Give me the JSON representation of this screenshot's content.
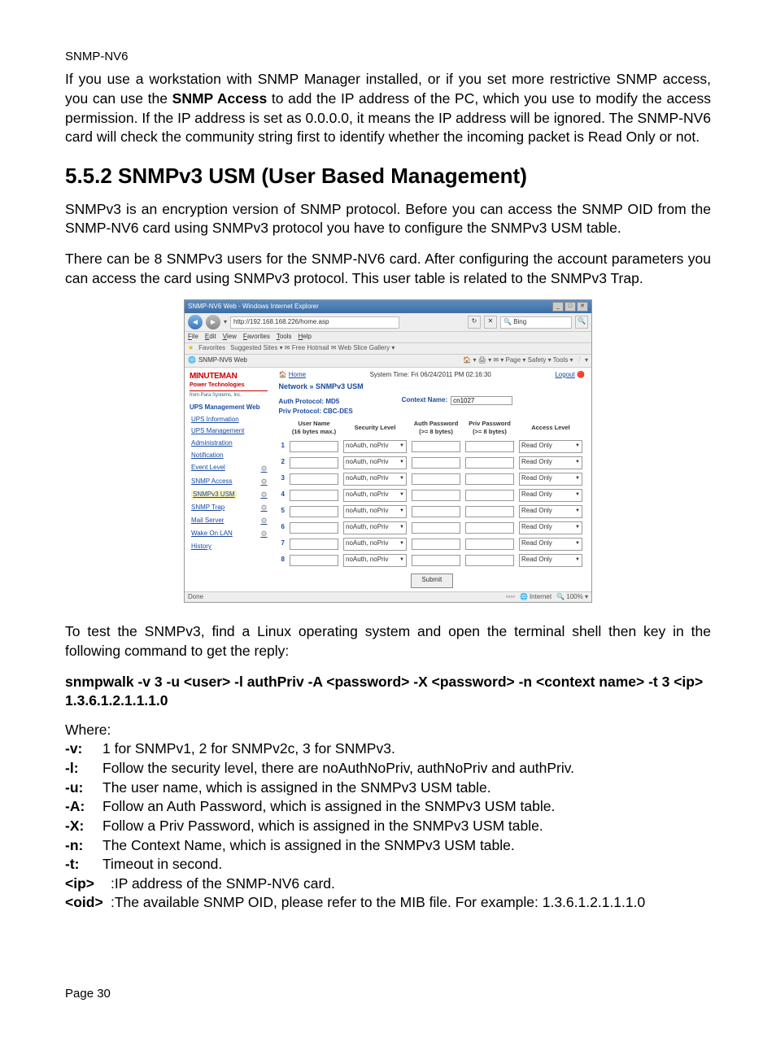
{
  "header": "SNMP-NV6",
  "intro_paragraph": "If you use a workstation with SNMP Manager installed, or if you set more restrictive SNMP access, you can use the SNMP Access to add the IP address of the PC, which you use to modify the access permission. If the IP address is set as 0.0.0.0, it means the IP address will be ignored. The SNMP-NV6 card will check the community string first to identify whether the incoming packet is Read Only or not.",
  "intro_bold": "SNMP Access",
  "section_heading": "5.5.2 SNMPv3 USM (User Based Management)",
  "para1": "SNMPv3 is an encryption version of SNMP protocol. Before you can access the SNMP OID from the SNMP-NV6 card using SNMPv3 protocol you have to configure the SNMPv3 USM table.",
  "para2": "There can be 8 SNMPv3 users for the SNMP-NV6 card. After configuring the account parameters you can access the card using SNMPv3 protocol. This user table is related to the SNMPv3 Trap.",
  "screenshot": {
    "title": "SNMP-NV6 Web - Windows Internet Explorer",
    "url": "http://192.168.168.226/home.asp",
    "search_hint": "Bing",
    "menu": [
      "File",
      "Edit",
      "View",
      "Favorites",
      "Tools",
      "Help"
    ],
    "fav_label": "Favorites",
    "fav_links": "Suggested Sites ▾  ✉ Free Hotmail  ✉ Web Slice Gallery ▾",
    "tab": "SNMP-NV6 Web",
    "toolbar_right": "🏠 ▾  🖨 ▾  ✉ ▾  Page ▾  Safety ▾  Tools ▾  ❔ ▾",
    "logo1": "MINUTEMAN",
    "logo2": "Power Technologies",
    "logo3": "from Para Systems, Inc.",
    "sidebar_section": "UPS Management Web",
    "sidebar_items": [
      "UPS Information",
      "UPS Management",
      "Administration",
      "Notification"
    ],
    "sidebar_sub": [
      {
        "label": "Event Level",
        "gear": true
      },
      {
        "label": "SNMP Access",
        "gear": true
      },
      {
        "label": "SNMPv3 USM",
        "gear": true,
        "selected": true
      },
      {
        "label": "SNMP Trap",
        "gear": true
      },
      {
        "label": "Mail Server",
        "gear": true
      },
      {
        "label": "Wake On LAN",
        "gear": true
      },
      {
        "label": "History",
        "gear": false
      }
    ],
    "home_link": "Home",
    "system_time": "System Time: Fri 06/24/2011 PM 02:16:30",
    "logout": "Logout",
    "breadcrumb": "Network » SNMPv3 USM",
    "auth_proto": "Auth Protocol: MD5",
    "priv_proto": "Priv Protocol: CBC-DES",
    "context_label": "Context Name:",
    "context_value": "cn1027",
    "columns": [
      "",
      "User Name\n(16 bytes max.)",
      "Security Level",
      "Auth Password\n(>= 8 bytes)",
      "Priv Password\n(>= 8 bytes)",
      "Access Level"
    ],
    "rows": [
      1,
      2,
      3,
      4,
      5,
      6,
      7,
      8
    ],
    "security_option": "noAuth, noPriv",
    "access_option": "Read Only",
    "submit": "Submit",
    "status_left": "Done",
    "status_zone": "Internet",
    "status_zoom": "100%"
  },
  "para3": "To test the SNMPv3, find a Linux operating system and open the terminal shell then key in the following command to get the reply:",
  "command": "snmpwalk -v 3 -u <user> -l authPriv -A <password> -X <password> -n <context name> -t 3 <ip> 1.3.6.1.2.1.1.1.0",
  "where_label": "Where:",
  "where": [
    {
      "k": "-v:",
      "v": "1 for SNMPv1, 2 for SNMPv2c, 3 for SNMPv3."
    },
    {
      "k": "-l:",
      "v": "Follow the security level, there are noAuthNoPriv, authNoPriv and authPriv."
    },
    {
      "k": "-u:",
      "v": "The user name, which is assigned in the SNMPv3 USM table."
    },
    {
      "k": "-A:",
      "v": "Follow an Auth Password, which is assigned in the SNMPv3 USM table."
    },
    {
      "k": "-X:",
      "v": "Follow a Priv Password, which is assigned in the SNMPv3 USM table."
    },
    {
      "k": "-n:",
      "v": "The Context Name, which is assigned in the SNMPv3 USM table."
    },
    {
      "k": "-t:",
      "v": "Timeout in second."
    }
  ],
  "where_extra": [
    {
      "k": "<ip>",
      "v": ":IP address of the SNMP-NV6 card."
    },
    {
      "k": "<oid>",
      "v": ":The available SNMP OID, please refer to the MIB file. For example: 1.3.6.1.2.1.1.1.0"
    }
  ],
  "footer": "Page 30"
}
